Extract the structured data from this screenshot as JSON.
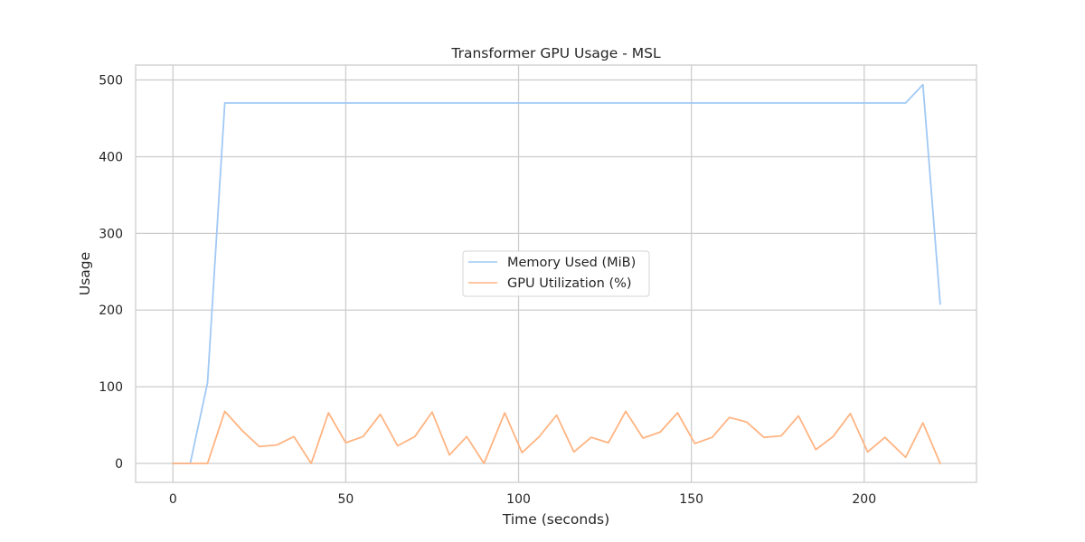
{
  "chart_data": {
    "type": "line",
    "title": "Transformer GPU Usage - MSL",
    "xlabel": "Time (seconds)",
    "ylabel": "Usage",
    "xlim": [
      -10.8,
      232.5
    ],
    "ylim": [
      -24.7,
      519.5
    ],
    "xticks": [
      0,
      50,
      100,
      150,
      200
    ],
    "yticks": [
      0,
      100,
      200,
      300,
      400,
      500
    ],
    "grid": true,
    "legend_position": "center",
    "series": [
      {
        "name": "Memory Used (MiB)",
        "color": "#a1c9f4",
        "x": [
          0,
          5,
          10,
          15,
          20,
          25,
          30,
          35,
          40,
          45,
          50,
          55,
          60,
          65,
          70,
          75,
          80,
          85,
          90,
          95,
          100,
          105,
          110,
          115,
          120,
          125,
          130,
          135,
          140,
          145,
          150,
          155,
          160,
          165,
          170,
          175,
          180,
          185,
          190,
          195,
          200,
          205,
          212,
          217,
          222
        ],
        "values": [
          0,
          0,
          105,
          470,
          470,
          470,
          470,
          470,
          470,
          470,
          470,
          470,
          470,
          470,
          470,
          470,
          470,
          470,
          470,
          470,
          470,
          470,
          470,
          470,
          470,
          470,
          470,
          470,
          470,
          470,
          470,
          470,
          470,
          470,
          470,
          470,
          470,
          470,
          470,
          470,
          470,
          470,
          470,
          494,
          208
        ]
      },
      {
        "name": "GPU Utilization (%)",
        "color": "#ffb482",
        "x": [
          0,
          5,
          10,
          15,
          20,
          25,
          30,
          35,
          40,
          45,
          50,
          55,
          60,
          65,
          70,
          75,
          80,
          85,
          90,
          96,
          101,
          106,
          111,
          116,
          121,
          126,
          131,
          136,
          141,
          146,
          151,
          156,
          161,
          166,
          171,
          176,
          181,
          186,
          191,
          196,
          201,
          206,
          212,
          217,
          222
        ],
        "values": [
          0,
          0,
          0,
          68,
          43,
          22,
          24,
          35,
          0,
          66,
          27,
          35,
          64,
          23,
          35,
          67,
          11,
          35,
          0,
          66,
          14,
          35,
          63,
          15,
          34,
          27,
          68,
          33,
          41,
          66,
          26,
          34,
          60,
          54,
          34,
          36,
          62,
          18,
          35,
          65,
          15,
          34,
          8,
          53,
          0
        ]
      }
    ]
  }
}
